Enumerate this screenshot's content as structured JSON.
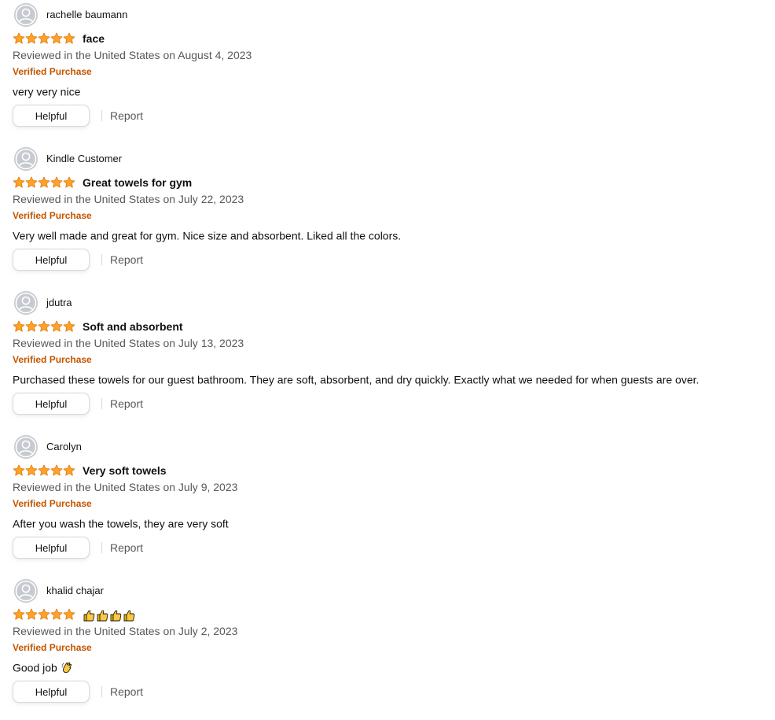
{
  "colors": {
    "star": "#ffa41c",
    "verified": "#c45500",
    "meta": "#565959",
    "text": "#0f1111",
    "button_border": "#d5d9d9"
  },
  "reviews": [
    {
      "author": "rachelle baumann",
      "rating": 5,
      "title": "face",
      "title_emoji": "",
      "date": "Reviewed in the United States on August 4, 2023",
      "verified": "Verified Purchase",
      "body": "very very nice",
      "body_emoji": "",
      "helpful_label": "Helpful",
      "report_label": "Report"
    },
    {
      "author": "Kindle Customer",
      "rating": 5,
      "title": "Great towels for gym",
      "title_emoji": "",
      "date": "Reviewed in the United States on July 22, 2023",
      "verified": "Verified Purchase",
      "body": "Very well made and great for gym. Nice size and absorbent. Liked all the colors.",
      "body_emoji": "",
      "helpful_label": "Helpful",
      "report_label": "Report"
    },
    {
      "author": "jdutra",
      "rating": 5,
      "title": "Soft and absorbent",
      "title_emoji": "",
      "date": "Reviewed in the United States on July 13, 2023",
      "verified": "Verified Purchase",
      "body": "Purchased these towels for our guest bathroom. They are soft, absorbent, and dry quickly. Exactly what we needed for when guests are over.",
      "body_emoji": "",
      "helpful_label": "Helpful",
      "report_label": "Report"
    },
    {
      "author": "Carolyn",
      "rating": 5,
      "title": "Very soft towels",
      "title_emoji": "",
      "date": "Reviewed in the United States on July 9, 2023",
      "verified": "Verified Purchase",
      "body": "After you wash the towels, they are very soft",
      "body_emoji": "",
      "helpful_label": "Helpful",
      "report_label": "Report"
    },
    {
      "author": "khalid chajar",
      "rating": 5,
      "title": "",
      "title_emoji": "👍👍👍👍",
      "date": "Reviewed in the United States on July 2, 2023",
      "verified": "Verified Purchase",
      "body": "Good job",
      "body_emoji": "👏",
      "helpful_label": "Helpful",
      "report_label": "Report"
    }
  ]
}
